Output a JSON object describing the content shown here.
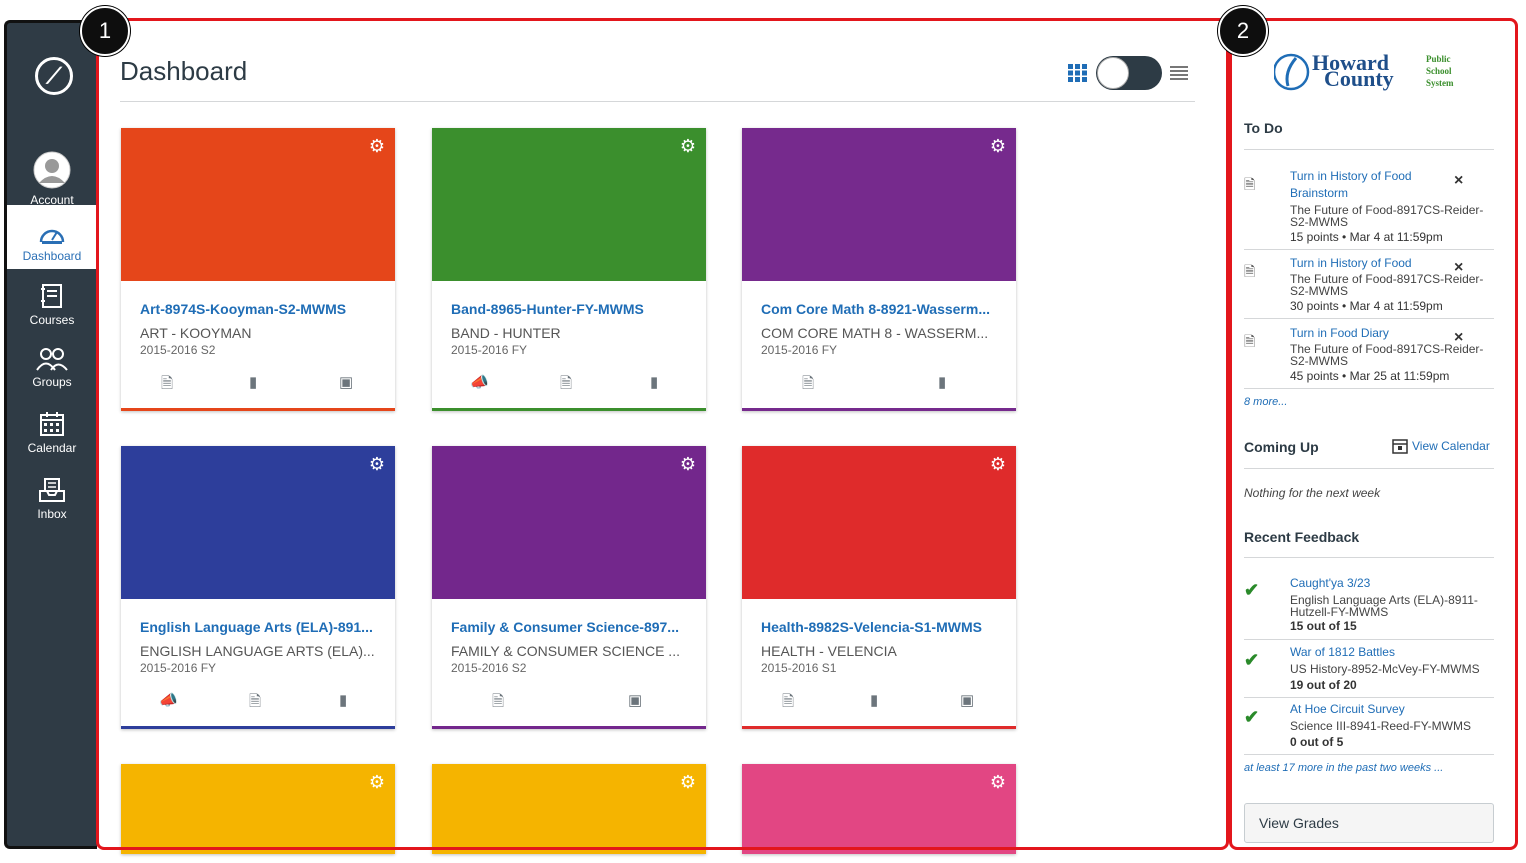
{
  "nav": {
    "items": [
      {
        "label": "Account"
      },
      {
        "label": "Dashboard"
      },
      {
        "label": "Courses"
      },
      {
        "label": "Groups"
      },
      {
        "label": "Calendar"
      },
      {
        "label": "Inbox"
      }
    ]
  },
  "badges": {
    "one": "1",
    "two": "2"
  },
  "dashboard": {
    "title": "Dashboard"
  },
  "cards": [
    {
      "name": "Art-8974S-Kooyman-S2-MWMS",
      "code": "ART - KOOYMAN",
      "term": "2015-2016 S2",
      "color": "#e5461a"
    },
    {
      "name": "Band-8965-Hunter-FY-MWMS",
      "code": "BAND - HUNTER",
      "term": "2015-2016 FY",
      "color": "#3b8f2d"
    },
    {
      "name": "Com Core Math 8-8921-Wasserm...",
      "code": "COM CORE MATH 8 - WASSERM...",
      "term": "2015-2016 FY",
      "color": "#762a8d"
    },
    {
      "name": "English Language Arts (ELA)-891...",
      "code": "ENGLISH LANGUAGE ARTS (ELA)...",
      "term": "2015-2016 FY",
      "color": "#2d3e9b"
    },
    {
      "name": "Family & Consumer Science-897...",
      "code": "FAMILY & CONSUMER SCIENCE ...",
      "term": "2015-2016 S2",
      "color": "#73278c"
    },
    {
      "name": "Health-8982S-Velencia-S1-MWMS",
      "code": "HEALTH - VELENCIA",
      "term": "2015-2016 S1",
      "color": "#df2b2b"
    },
    {
      "color": "#f5b400"
    },
    {
      "color": "#f5b400"
    },
    {
      "color": "#e24683"
    }
  ],
  "logo": {
    "line1": "Howard",
    "line2": "County",
    "side1": "Public",
    "side2": "School",
    "side3": "System"
  },
  "todo": {
    "heading": "To Do",
    "items": [
      {
        "title": "Turn in History of Food Brainstorm",
        "course": "The Future of Food-8917CS-Reider-S2-MWMS",
        "meta": "15 points • Mar 4 at 11:59pm"
      },
      {
        "title": "Turn in History of Food",
        "course": "The Future of Food-8917CS-Reider-S2-MWMS",
        "meta": "30 points • Mar 4 at 11:59pm"
      },
      {
        "title": "Turn in Food Diary",
        "course": "The Future of Food-8917CS-Reider-S2-MWMS",
        "meta": "45 points • Mar 25 at 11:59pm"
      }
    ],
    "more": "8 more..."
  },
  "coming_up": {
    "heading": "Coming Up",
    "calendar_link": "View Calendar",
    "empty": "Nothing for the next week"
  },
  "feedback": {
    "heading": "Recent Feedback",
    "items": [
      {
        "title": "Caught'ya 3/23",
        "course": "English Language Arts (ELA)-8911-Hutzell-FY-MWMS",
        "score": "15 out of 15"
      },
      {
        "title": "War of 1812 Battles",
        "course": "US History-8952-McVey-FY-MWMS",
        "score": "19 out of 20"
      },
      {
        "title": "At Hoe Circuit Survey",
        "course": "Science III-8941-Reed-FY-MWMS",
        "score": "0 out of 5"
      }
    ],
    "more": "at least 17 more in the past two weeks ..."
  },
  "view_grades": "View Grades",
  "icons": {
    "close": "×",
    "gear": "⚙",
    "check": "✔"
  }
}
